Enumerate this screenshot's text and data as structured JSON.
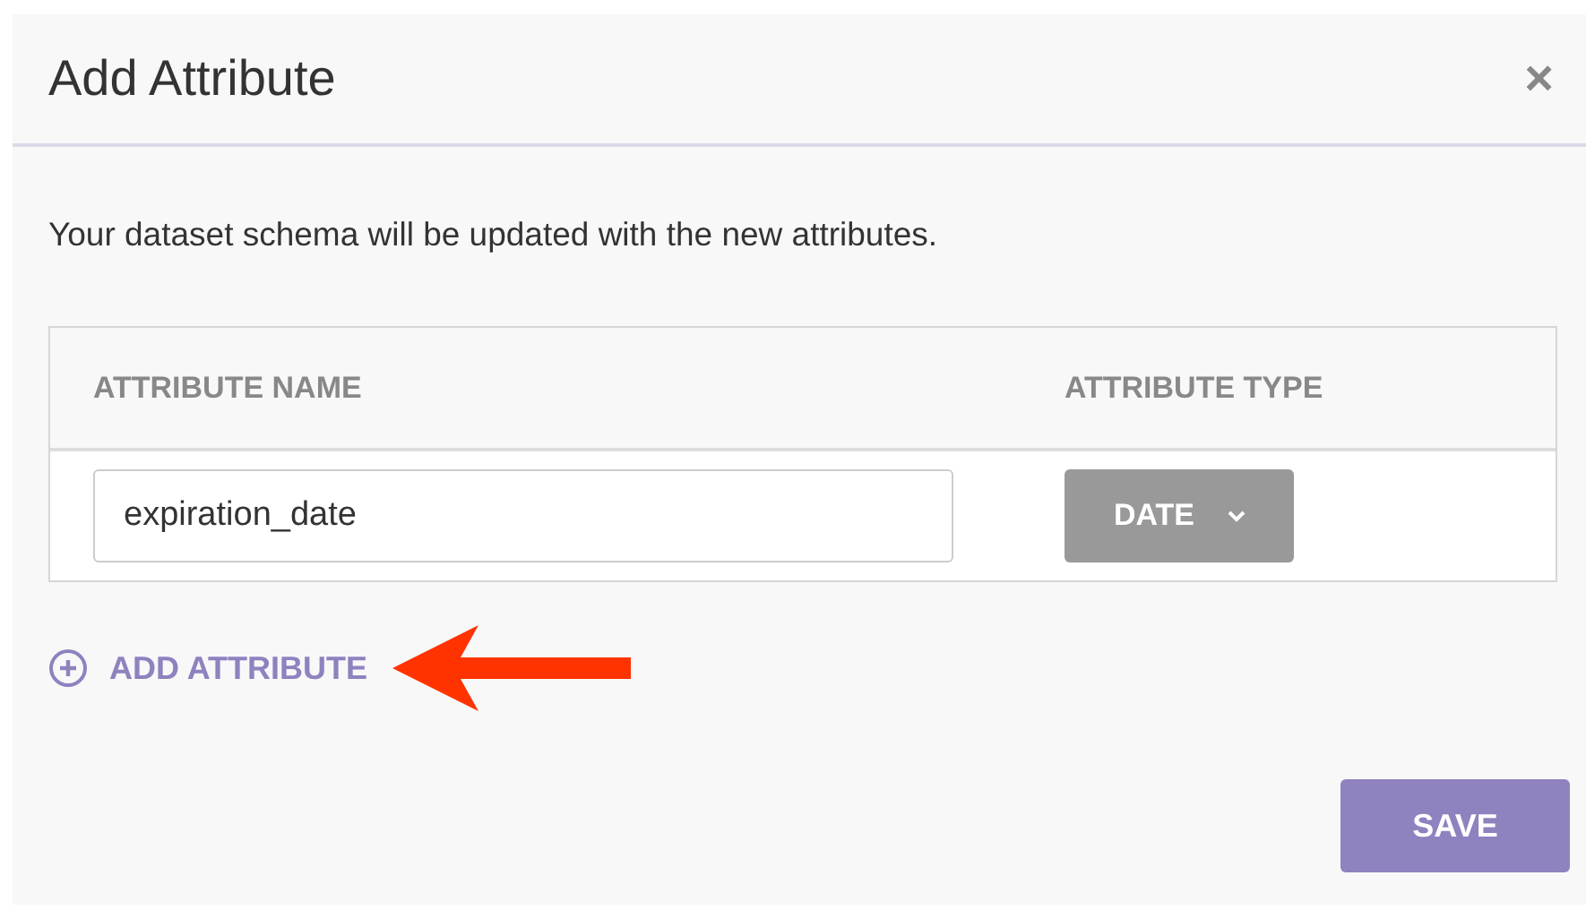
{
  "dialog": {
    "title": "Add Attribute",
    "close": "×"
  },
  "description": "Your dataset schema will be updated with the new attributes.",
  "table": {
    "columns": [
      "ATTRIBUTE NAME",
      "ATTRIBUTE TYPE"
    ],
    "rows": [
      {
        "name": "expiration_date",
        "type": "DATE"
      }
    ]
  },
  "add_attribute": "ADD ATTRIBUTE",
  "buttons": [
    "SAVE"
  ]
}
